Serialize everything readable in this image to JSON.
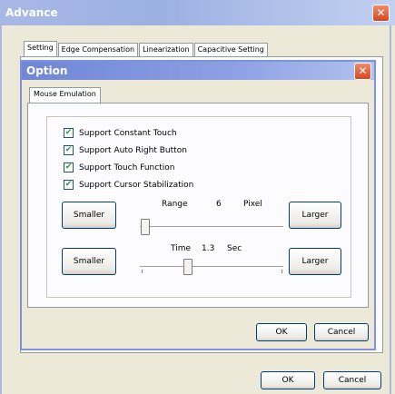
{
  "outer_window": {
    "title": "Advance",
    "close_glyph": "✕"
  },
  "outer_tabs": [
    "Setting",
    "Edge Compensation",
    "Linearization",
    "Capacitive Setting"
  ],
  "option_dialog": {
    "title": "Option",
    "close_glyph": "✕",
    "tab": "Mouse Emulation",
    "checkboxes": [
      {
        "label": "Support Constant Touch",
        "checked": true
      },
      {
        "label": "Support Auto Right Button",
        "checked": true
      },
      {
        "label": "Support Touch Function",
        "checked": true
      },
      {
        "label": "Support Cursor Stabilization",
        "checked": true
      }
    ],
    "range": {
      "label": "Range",
      "value": "6",
      "unit": "Pixel",
      "smaller": "Smaller",
      "larger": "Larger"
    },
    "time": {
      "label": "Time",
      "value": "1.3",
      "unit": "Sec",
      "smaller": "Smaller",
      "larger": "Larger"
    },
    "ok": "OK",
    "cancel": "Cancel"
  },
  "outer_buttons": {
    "ok": "OK",
    "cancel": "Cancel"
  },
  "check_glyph": "✔"
}
